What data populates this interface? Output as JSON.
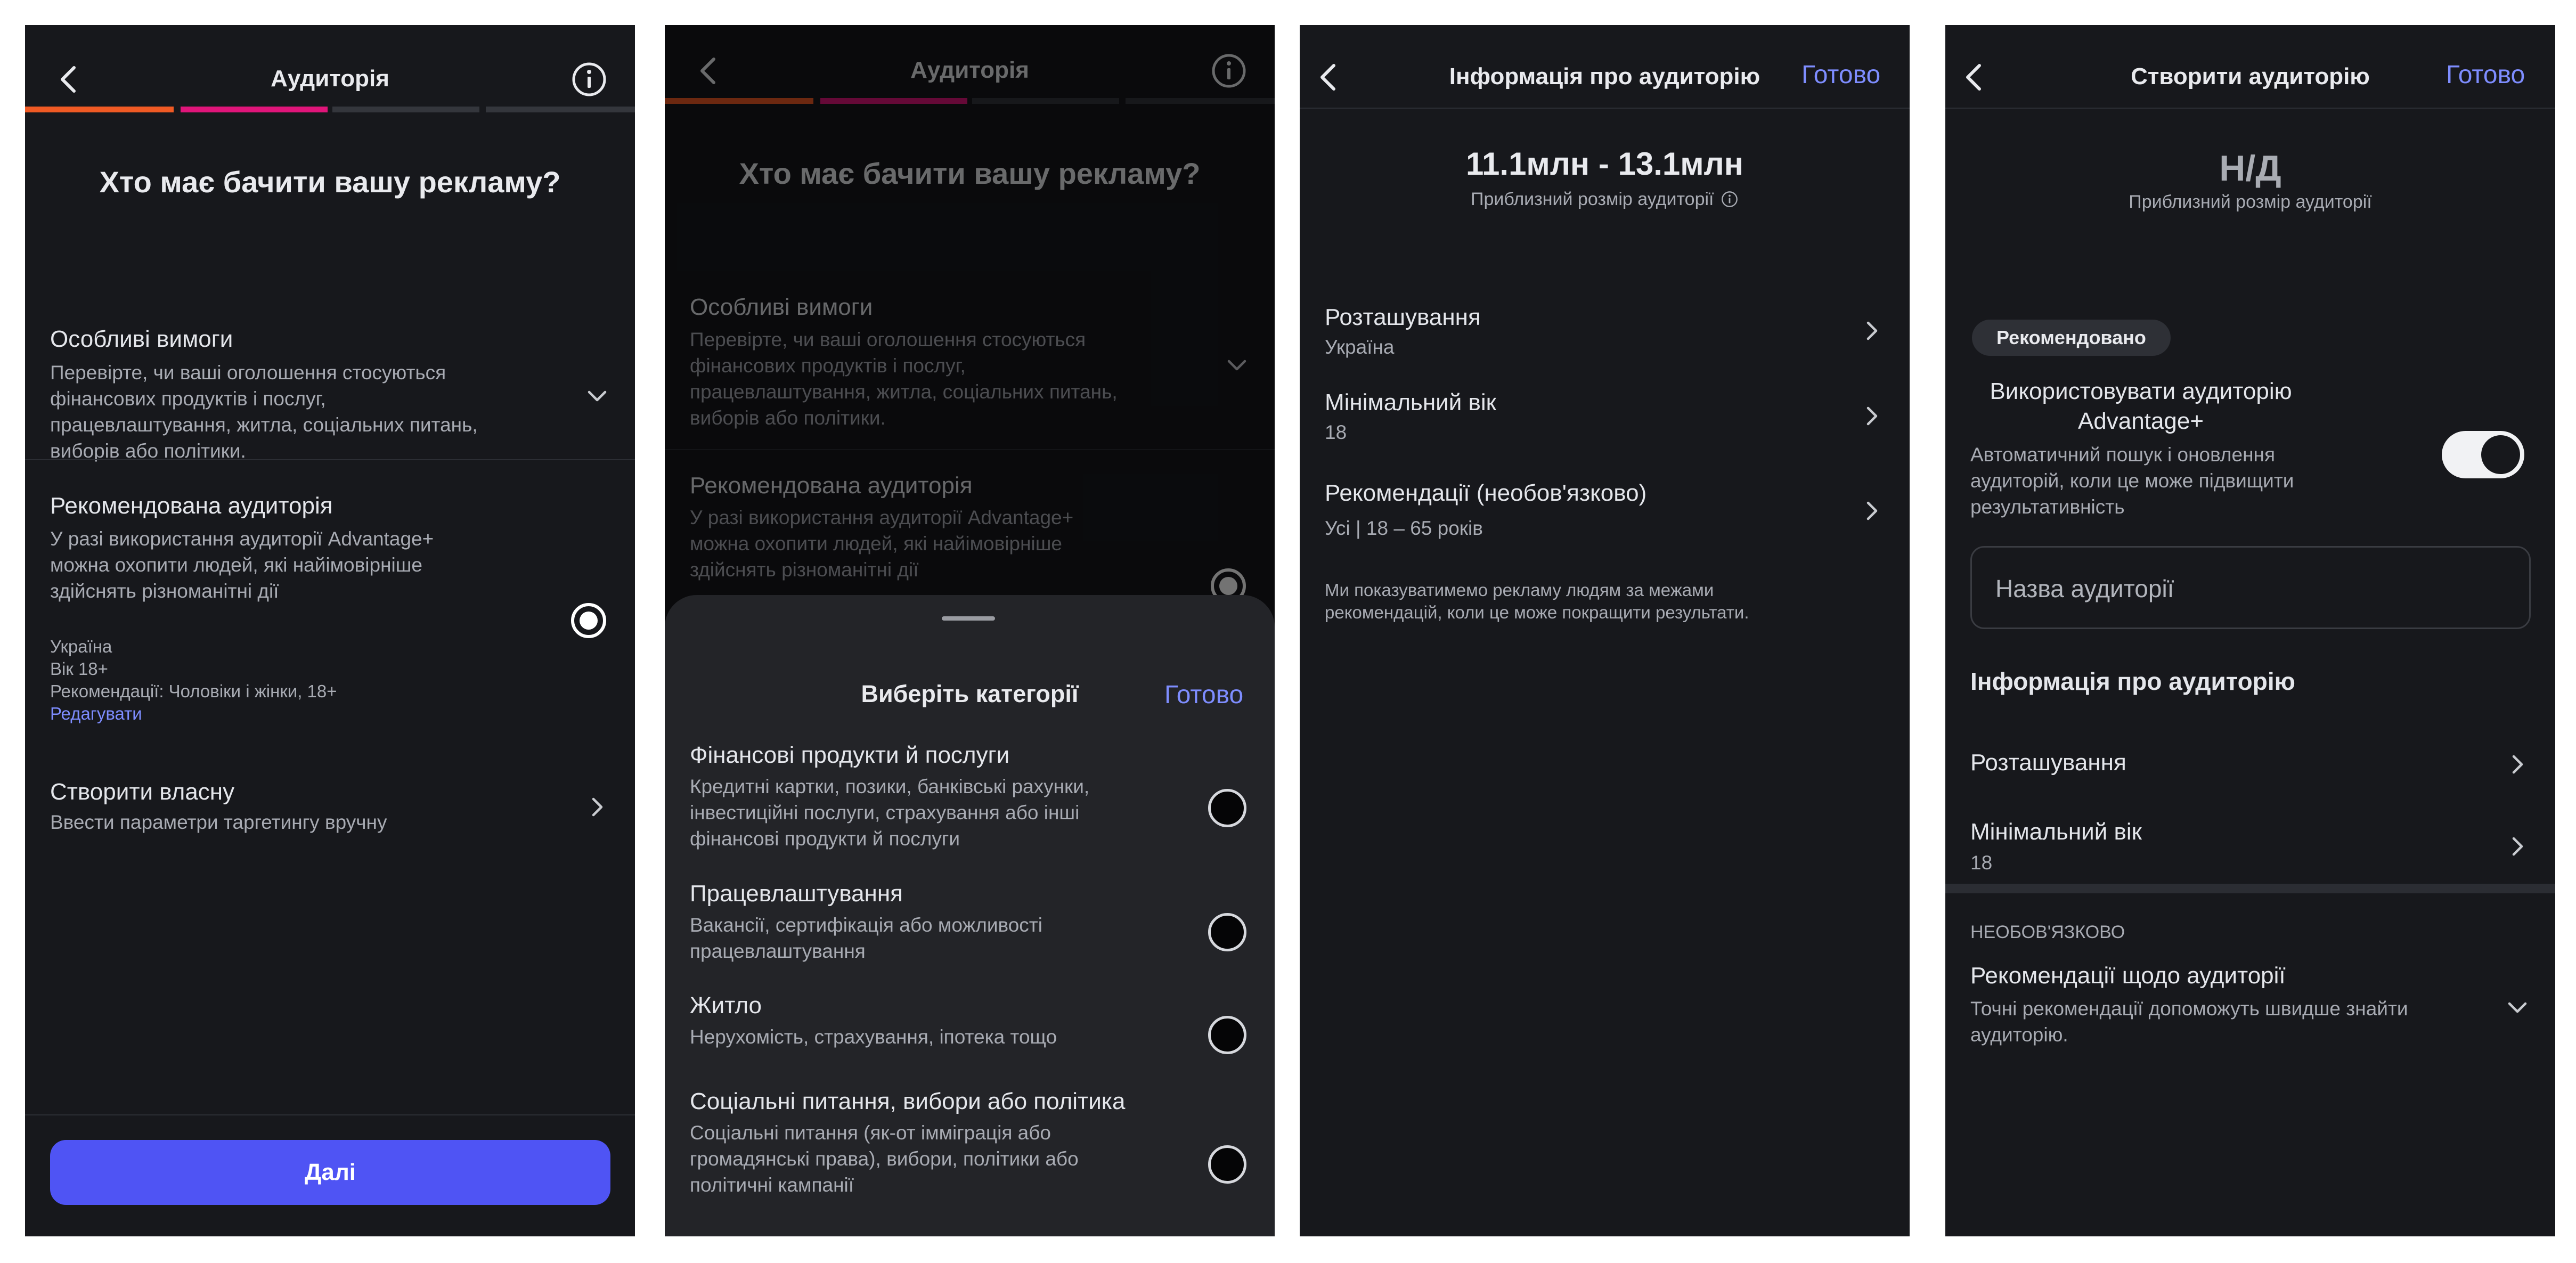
{
  "colors": {
    "background": "#17181c",
    "accent": "#7e8dff",
    "button": "#4f54f4",
    "progress_orange": "#f05a24",
    "progress_pink": "#e0157a"
  },
  "screen1": {
    "title": "Аудиторія",
    "heading": "Хто має бачити вашу рекламу?",
    "special": {
      "title": "Особливі вимоги",
      "lines": [
        "Перевірте, чи ваші оголошення стосуються",
        "фінансових продуктів і послуг,",
        "працевлаштування, житла, соціальних питань,",
        "виборів або політики."
      ]
    },
    "recommended": {
      "title": "Рекомендована аудиторія",
      "lines": [
        "У разі використання аудиторії Advantage+",
        "можна охопити людей, які найімовірніше",
        "здійснять різноманітні дії"
      ],
      "details": [
        "Україна",
        "Вік 18+",
        "Рекомендації: Чоловіки і жінки, 18+"
      ],
      "edit": "Редагувати"
    },
    "custom": {
      "title": "Створити власну",
      "subtitle": "Ввести параметри таргетингу вручну"
    },
    "next": "Далі"
  },
  "screen2": {
    "sheet_title": "Виберіть категорії",
    "done": "Готово",
    "categories": [
      {
        "title": "Фінансові продукти й послуги",
        "lines": [
          "Кредитні картки, позики, банківські рахунки,",
          "інвестиційні послуги, страхування або інші",
          "фінансові продукти й послуги"
        ]
      },
      {
        "title": "Працевлаштування",
        "lines": [
          "Вакансії, сертифікація або можливості",
          "працевлаштування"
        ]
      },
      {
        "title": "Житло",
        "lines": [
          "Нерухомість, страхування, іпотека тощо"
        ]
      },
      {
        "title": "Соціальні питання, вибори або політика",
        "lines": [
          "Соціальні питання (як-от імміграція або",
          "громадянські права), вибори, політики або",
          "політичні кампанії"
        ]
      }
    ]
  },
  "screen3": {
    "title": "Інформація про аудиторію",
    "done": "Готово",
    "size": "11.1млн - 13.1млн",
    "size_label": "Приблизний розмір аудиторії",
    "rows": [
      {
        "title": "Розташування",
        "value": "Україна"
      },
      {
        "title": "Мінімальний вік",
        "value": "18"
      },
      {
        "title": "Рекомендації (необов'язково)",
        "value": "Усі | 18 – 65 років"
      }
    ],
    "note": [
      "Ми показуватимемо рекламу людям за межами",
      "рекомендацій, коли це може покращити результати."
    ]
  },
  "screen4": {
    "title": "Створити аудиторію",
    "done": "Готово",
    "size": "Н/Д",
    "size_label": "Приблизний розмір аудиторії",
    "badge": "Рекомендовано",
    "advantage_title": [
      "Використовувати аудиторію",
      "Advantage+"
    ],
    "advantage_lines": [
      "Автоматичний пошук і оновлення",
      "аудиторій, коли це може підвищити",
      "результативність"
    ],
    "toggle_on": true,
    "name_placeholder": "Назва аудиторії",
    "section_title": "Інформація про аудиторію",
    "location": "Розташування",
    "min_age_title": "Мінімальний вік",
    "min_age_value": "18",
    "optional_label": "НЕОБОВ'ЯЗКОВО",
    "recs_title": "Рекомендації щодо аудиторії",
    "recs_lines": [
      "Точні рекомендації допоможуть швидше знайти",
      "аудиторію."
    ]
  }
}
